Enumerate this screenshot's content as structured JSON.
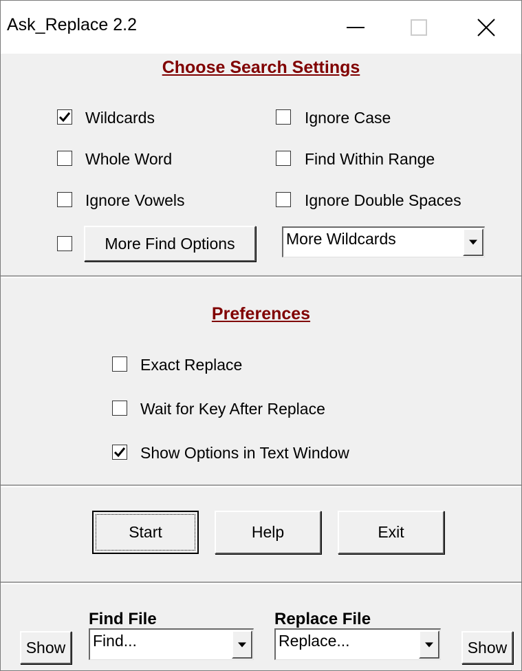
{
  "window": {
    "title": "Ask_Replace  2.2"
  },
  "search_settings": {
    "heading": "Choose Search Settings",
    "options": {
      "wildcards": {
        "label": "Wildcards",
        "checked": true
      },
      "ignore_case": {
        "label": "Ignore Case",
        "checked": false
      },
      "whole_word": {
        "label": "Whole Word",
        "checked": false
      },
      "find_within_range": {
        "label": "Find Within Range",
        "checked": false
      },
      "ignore_vowels": {
        "label": "Ignore Vowels",
        "checked": false
      },
      "ignore_double_spaces": {
        "label": "Ignore Double Spaces",
        "checked": false
      },
      "more_find_options": {
        "checked": false
      }
    },
    "more_find_options_button": "More Find Options",
    "more_wildcards_select": "More Wildcards"
  },
  "preferences": {
    "heading": "Preferences",
    "options": {
      "exact_replace": {
        "label": "Exact Replace",
        "checked": false
      },
      "wait_for_key": {
        "label": "Wait for Key After Replace",
        "checked": false
      },
      "show_options": {
        "label": "Show Options in Text Window",
        "checked": true
      }
    }
  },
  "actions": {
    "start": "Start",
    "help": "Help",
    "exit": "Exit"
  },
  "files": {
    "find_label": "Find File",
    "find_value": "Find...",
    "replace_label": "Replace File",
    "replace_value": "Replace...",
    "show_left": "Show",
    "show_right": "Show"
  },
  "icons": {
    "minimize": "minimize-icon",
    "maximize": "maximize-icon",
    "close": "close-icon",
    "check": "checkmark-icon",
    "dropdown": "dropdown-arrow-icon"
  },
  "colors": {
    "heading": "#800000",
    "face": "#f0f0f0"
  }
}
